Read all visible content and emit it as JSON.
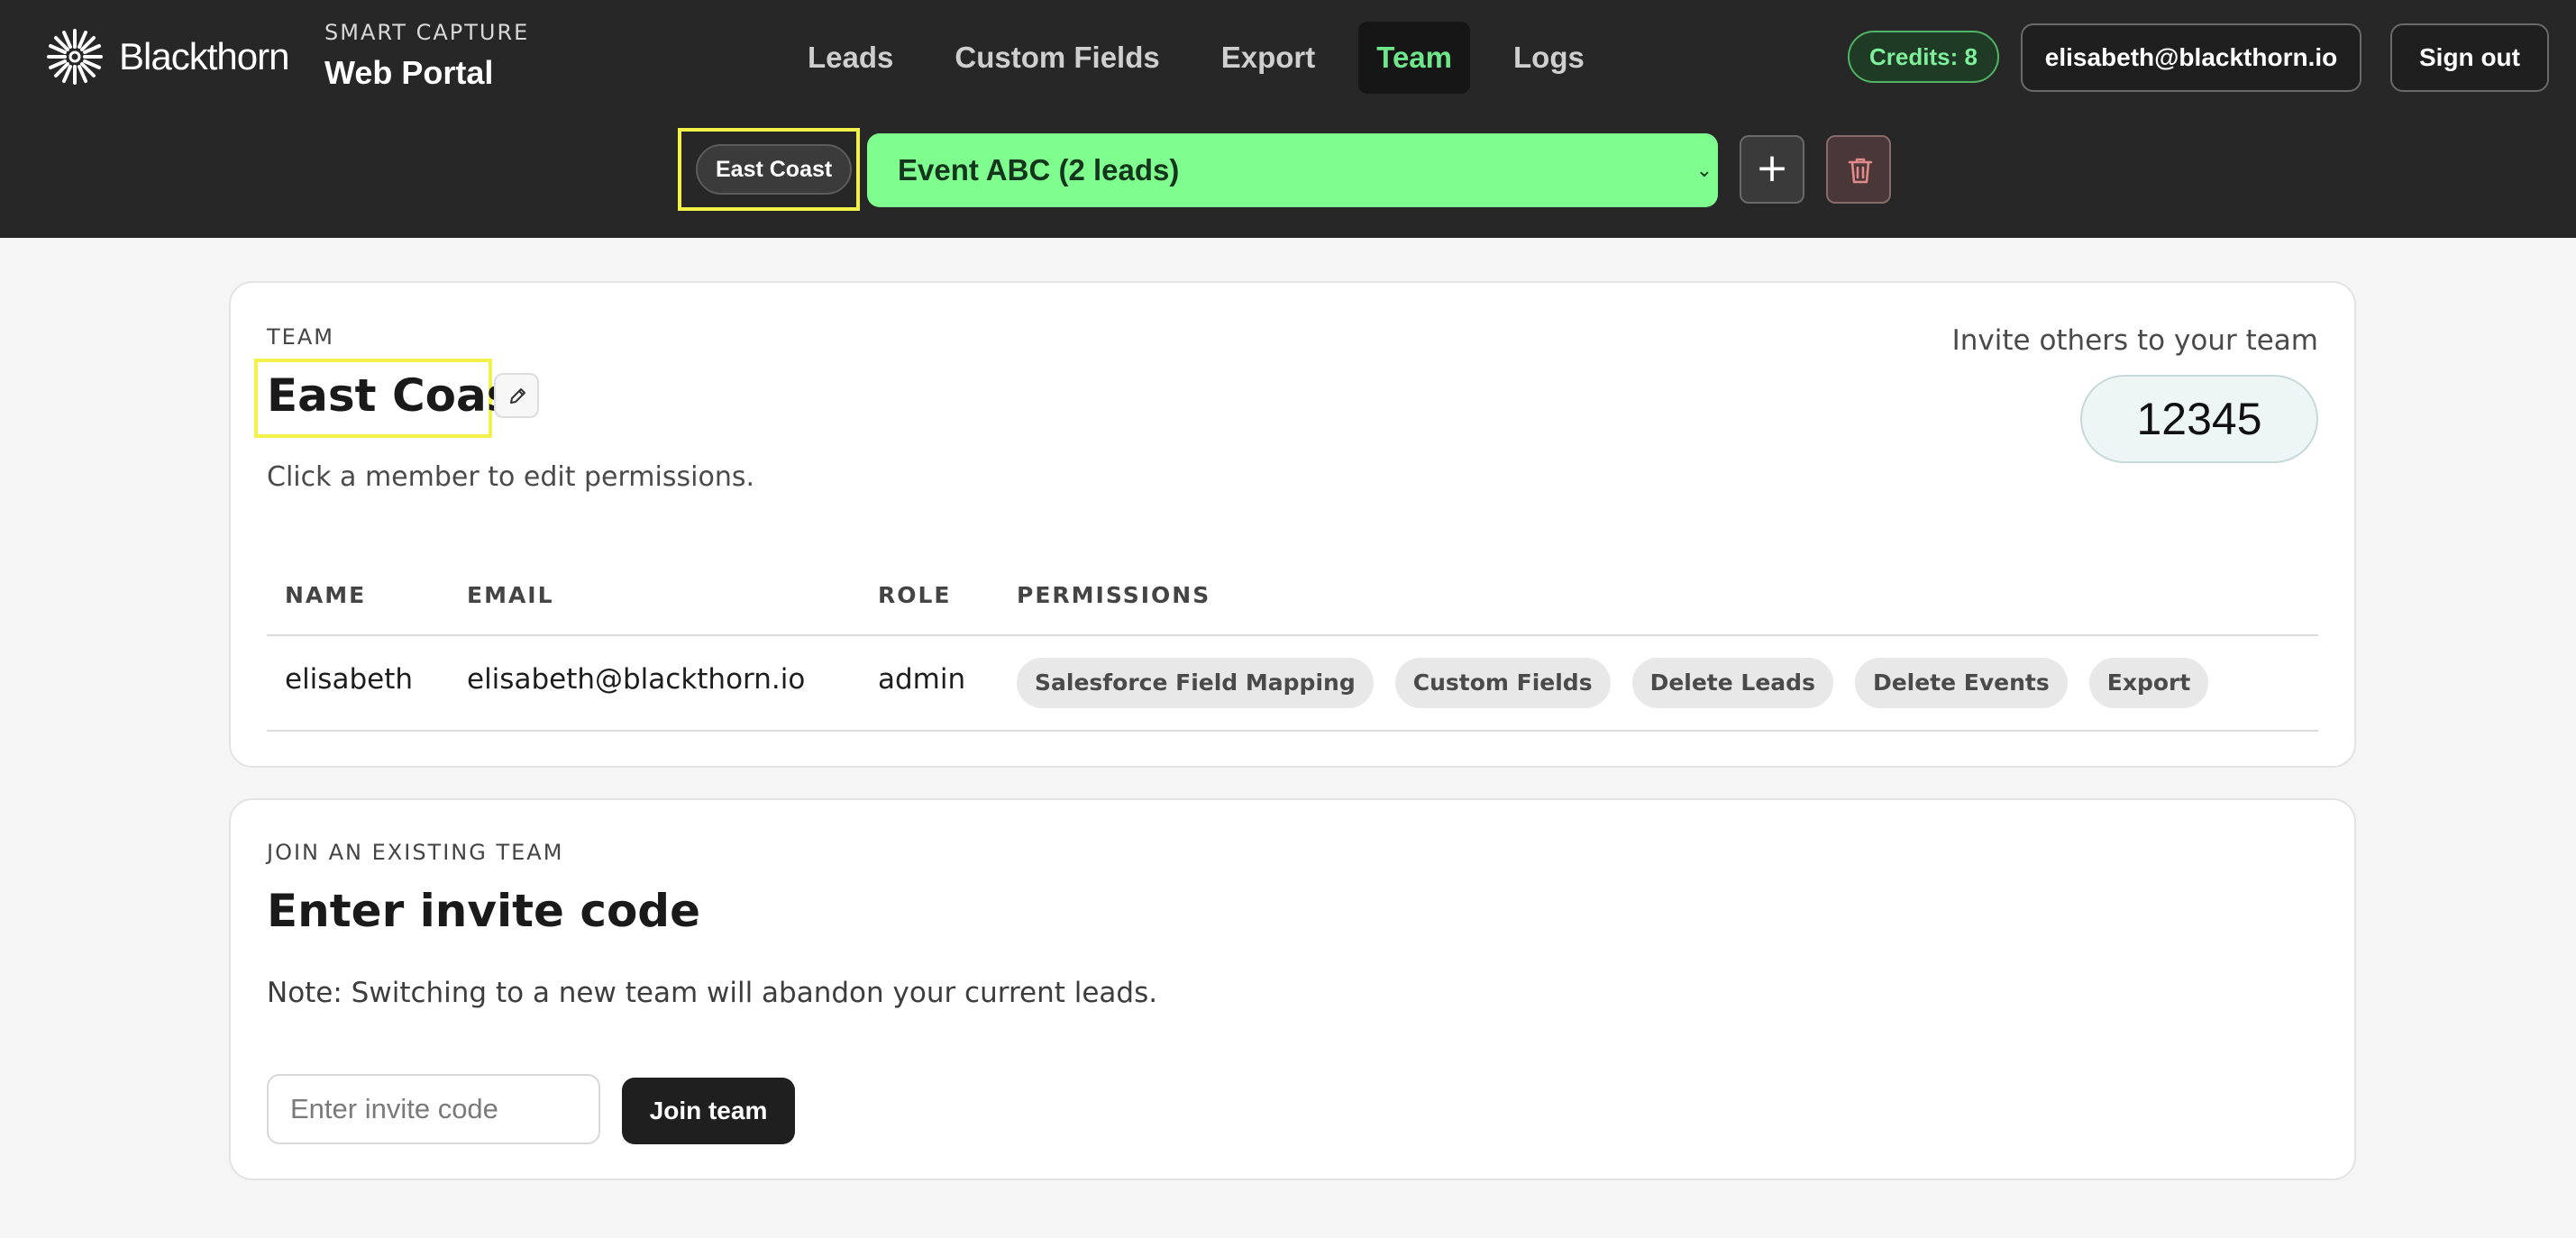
{
  "brand": {
    "name": "Blackthorn",
    "logo_icon": "starburst-logo-icon",
    "subtitle": "SMART CAPTURE",
    "portal": "Web Portal"
  },
  "nav": {
    "items": [
      {
        "label": "Leads"
      },
      {
        "label": "Custom Fields"
      },
      {
        "label": "Export"
      },
      {
        "label": "Team",
        "active": true
      },
      {
        "label": "Logs"
      }
    ]
  },
  "account": {
    "credits": "Credits: 8",
    "email": "elisabeth@blackthorn.io",
    "sign_out": "Sign out"
  },
  "toolbar": {
    "team_chip": "East Coast",
    "event_selected": "Event ABC (2 leads)",
    "add_icon": "plus-icon",
    "delete_icon": "trash-icon"
  },
  "team_card": {
    "eyebrow": "TEAM",
    "title": "East Coast",
    "hint": "Click a member to edit permissions.",
    "invite_label": "Invite others to your team",
    "invite_code": "12345",
    "columns": [
      "NAME",
      "EMAIL",
      "ROLE",
      "PERMISSIONS"
    ],
    "members": [
      {
        "name": "elisabeth",
        "email": "elisabeth@blackthorn.io",
        "role": "admin",
        "permissions": [
          "Salesforce Field Mapping",
          "Custom Fields",
          "Delete Leads",
          "Delete Events",
          "Export"
        ]
      }
    ]
  },
  "join_card": {
    "eyebrow": "JOIN AN EXISTING TEAM",
    "title": "Enter invite code",
    "note": "Note: Switching to a new team will abandon your current leads.",
    "input_placeholder": "Enter invite code",
    "input_value": "",
    "button": "Join team"
  },
  "colors": {
    "header_bg": "#272727",
    "accent_green": "#7ffd8f",
    "nav_active": "#6ee68a",
    "highlight_yellow": "#f3f24a"
  }
}
